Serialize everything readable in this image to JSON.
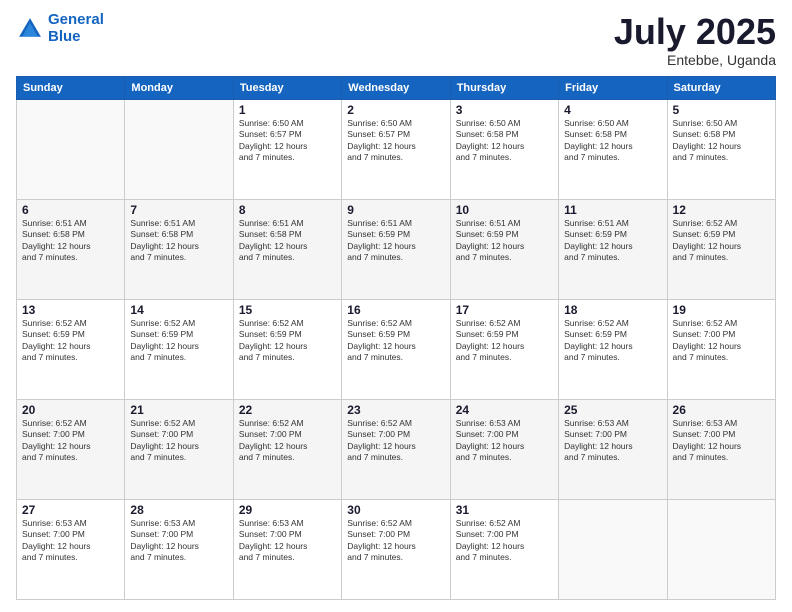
{
  "logo": {
    "line1": "General",
    "line2": "Blue"
  },
  "title": "July 2025",
  "subtitle": "Entebbe, Uganda",
  "days_of_week": [
    "Sunday",
    "Monday",
    "Tuesday",
    "Wednesday",
    "Thursday",
    "Friday",
    "Saturday"
  ],
  "weeks": [
    [
      {
        "num": "",
        "info": ""
      },
      {
        "num": "",
        "info": ""
      },
      {
        "num": "1",
        "info": "Sunrise: 6:50 AM\nSunset: 6:57 PM\nDaylight: 12 hours\nand 7 minutes."
      },
      {
        "num": "2",
        "info": "Sunrise: 6:50 AM\nSunset: 6:57 PM\nDaylight: 12 hours\nand 7 minutes."
      },
      {
        "num": "3",
        "info": "Sunrise: 6:50 AM\nSunset: 6:58 PM\nDaylight: 12 hours\nand 7 minutes."
      },
      {
        "num": "4",
        "info": "Sunrise: 6:50 AM\nSunset: 6:58 PM\nDaylight: 12 hours\nand 7 minutes."
      },
      {
        "num": "5",
        "info": "Sunrise: 6:50 AM\nSunset: 6:58 PM\nDaylight: 12 hours\nand 7 minutes."
      }
    ],
    [
      {
        "num": "6",
        "info": "Sunrise: 6:51 AM\nSunset: 6:58 PM\nDaylight: 12 hours\nand 7 minutes."
      },
      {
        "num": "7",
        "info": "Sunrise: 6:51 AM\nSunset: 6:58 PM\nDaylight: 12 hours\nand 7 minutes."
      },
      {
        "num": "8",
        "info": "Sunrise: 6:51 AM\nSunset: 6:58 PM\nDaylight: 12 hours\nand 7 minutes."
      },
      {
        "num": "9",
        "info": "Sunrise: 6:51 AM\nSunset: 6:59 PM\nDaylight: 12 hours\nand 7 minutes."
      },
      {
        "num": "10",
        "info": "Sunrise: 6:51 AM\nSunset: 6:59 PM\nDaylight: 12 hours\nand 7 minutes."
      },
      {
        "num": "11",
        "info": "Sunrise: 6:51 AM\nSunset: 6:59 PM\nDaylight: 12 hours\nand 7 minutes."
      },
      {
        "num": "12",
        "info": "Sunrise: 6:52 AM\nSunset: 6:59 PM\nDaylight: 12 hours\nand 7 minutes."
      }
    ],
    [
      {
        "num": "13",
        "info": "Sunrise: 6:52 AM\nSunset: 6:59 PM\nDaylight: 12 hours\nand 7 minutes."
      },
      {
        "num": "14",
        "info": "Sunrise: 6:52 AM\nSunset: 6:59 PM\nDaylight: 12 hours\nand 7 minutes."
      },
      {
        "num": "15",
        "info": "Sunrise: 6:52 AM\nSunset: 6:59 PM\nDaylight: 12 hours\nand 7 minutes."
      },
      {
        "num": "16",
        "info": "Sunrise: 6:52 AM\nSunset: 6:59 PM\nDaylight: 12 hours\nand 7 minutes."
      },
      {
        "num": "17",
        "info": "Sunrise: 6:52 AM\nSunset: 6:59 PM\nDaylight: 12 hours\nand 7 minutes."
      },
      {
        "num": "18",
        "info": "Sunrise: 6:52 AM\nSunset: 6:59 PM\nDaylight: 12 hours\nand 7 minutes."
      },
      {
        "num": "19",
        "info": "Sunrise: 6:52 AM\nSunset: 7:00 PM\nDaylight: 12 hours\nand 7 minutes."
      }
    ],
    [
      {
        "num": "20",
        "info": "Sunrise: 6:52 AM\nSunset: 7:00 PM\nDaylight: 12 hours\nand 7 minutes."
      },
      {
        "num": "21",
        "info": "Sunrise: 6:52 AM\nSunset: 7:00 PM\nDaylight: 12 hours\nand 7 minutes."
      },
      {
        "num": "22",
        "info": "Sunrise: 6:52 AM\nSunset: 7:00 PM\nDaylight: 12 hours\nand 7 minutes."
      },
      {
        "num": "23",
        "info": "Sunrise: 6:52 AM\nSunset: 7:00 PM\nDaylight: 12 hours\nand 7 minutes."
      },
      {
        "num": "24",
        "info": "Sunrise: 6:53 AM\nSunset: 7:00 PM\nDaylight: 12 hours\nand 7 minutes."
      },
      {
        "num": "25",
        "info": "Sunrise: 6:53 AM\nSunset: 7:00 PM\nDaylight: 12 hours\nand 7 minutes."
      },
      {
        "num": "26",
        "info": "Sunrise: 6:53 AM\nSunset: 7:00 PM\nDaylight: 12 hours\nand 7 minutes."
      }
    ],
    [
      {
        "num": "27",
        "info": "Sunrise: 6:53 AM\nSunset: 7:00 PM\nDaylight: 12 hours\nand 7 minutes."
      },
      {
        "num": "28",
        "info": "Sunrise: 6:53 AM\nSunset: 7:00 PM\nDaylight: 12 hours\nand 7 minutes."
      },
      {
        "num": "29",
        "info": "Sunrise: 6:53 AM\nSunset: 7:00 PM\nDaylight: 12 hours\nand 7 minutes."
      },
      {
        "num": "30",
        "info": "Sunrise: 6:52 AM\nSunset: 7:00 PM\nDaylight: 12 hours\nand 7 minutes."
      },
      {
        "num": "31",
        "info": "Sunrise: 6:52 AM\nSunset: 7:00 PM\nDaylight: 12 hours\nand 7 minutes."
      },
      {
        "num": "",
        "info": ""
      },
      {
        "num": "",
        "info": ""
      }
    ]
  ]
}
